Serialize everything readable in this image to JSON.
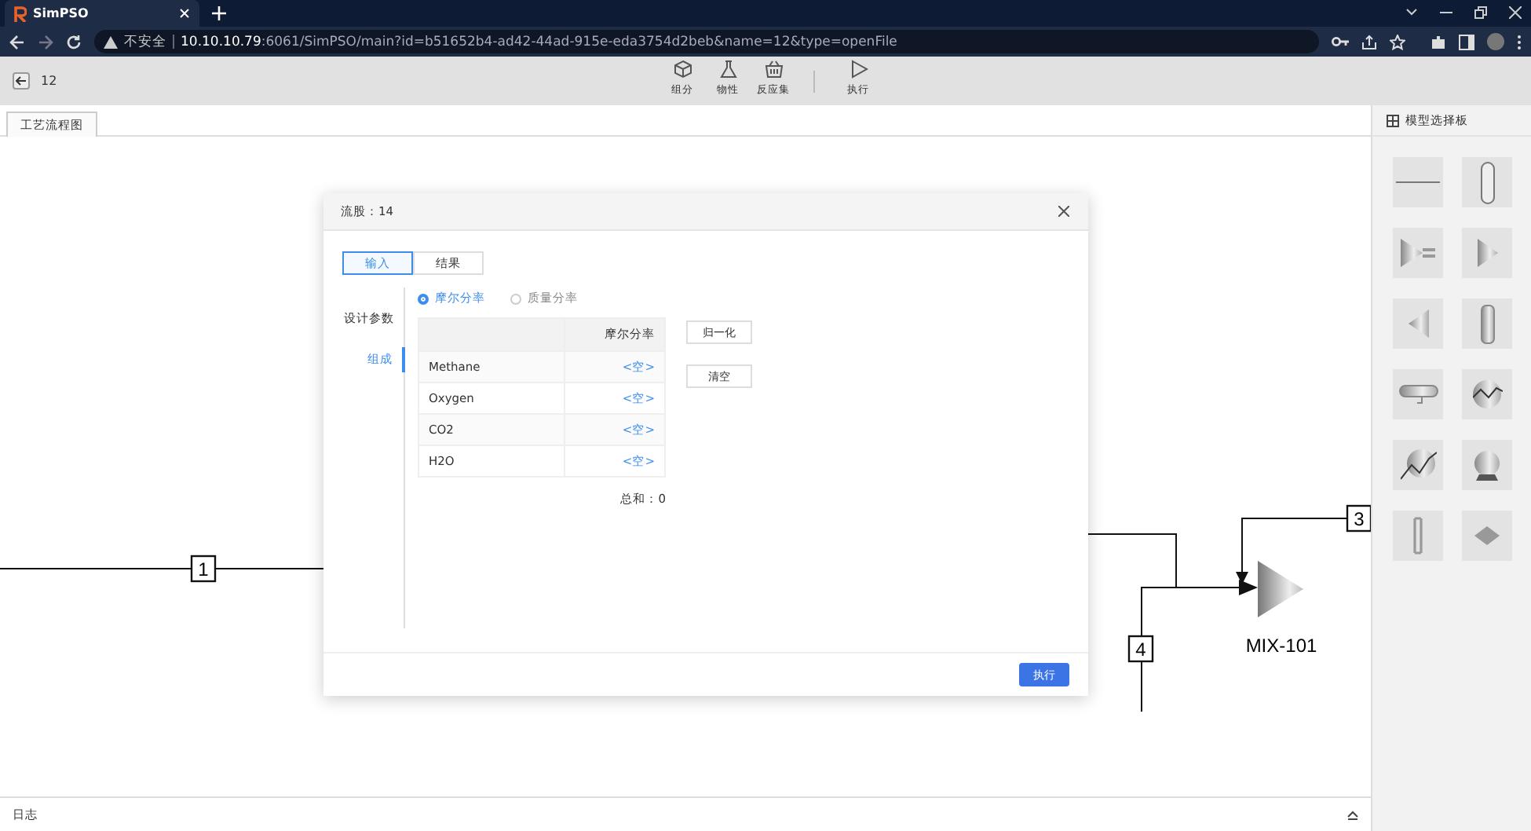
{
  "browser": {
    "tab_title": "SimPSO",
    "security": "不安全",
    "url": "**10.10.10.79**:6061/SimPSO/main?id=b51652b4-ad42-44ad-915e-eda3754d2beb&name=12&type=openFile"
  },
  "toolbar": {
    "file_name": "12",
    "tools": [
      {
        "kind": "cube",
        "label": "组分"
      },
      {
        "kind": "flask",
        "label": "物性"
      },
      {
        "kind": "basket",
        "label": "反应集"
      },
      {
        "kind": "play",
        "label": "执行"
      }
    ]
  },
  "doc_tab": "工艺流程图",
  "diagram": {
    "streams": [
      {
        "kind": "feed",
        "label": "1"
      },
      {
        "kind": "top",
        "label": "3"
      },
      {
        "kind": "bottom",
        "label": "4"
      }
    ],
    "unit": "MIX-101"
  },
  "dialog": {
    "title": "流股：14",
    "tabs": [
      {
        "label": "输入",
        "selected": true
      },
      {
        "label": "结果",
        "selected": false
      }
    ],
    "nav_heading": "设计参数",
    "nav_items": [
      {
        "label": "组成",
        "selected": true
      }
    ],
    "radios": [
      {
        "label": "摩尔分率",
        "selected": true
      },
      {
        "label": "质量分率",
        "selected": false
      }
    ],
    "table": {
      "column_header": "摩尔分率",
      "rows": [
        {
          "name": "Methane",
          "value": "<空>"
        },
        {
          "name": "Oxygen",
          "value": "<空>"
        },
        {
          "name": "CO2",
          "value": "<空>"
        },
        {
          "name": "H2O",
          "value": "<空>"
        }
      ]
    },
    "buttons": [
      "归一化",
      "清空"
    ],
    "sum": "总和：0",
    "run_button": "执行"
  },
  "palette": {
    "title": "模型选择板",
    "items": [
      {
        "kind": "line"
      },
      {
        "kind": "capsule"
      },
      {
        "kind": "splitter"
      },
      {
        "kind": "mixer"
      },
      {
        "kind": "reverse"
      },
      {
        "kind": "column"
      },
      {
        "kind": "drum"
      },
      {
        "kind": "exchanger"
      },
      {
        "kind": "heater"
      },
      {
        "kind": "compressor"
      },
      {
        "kind": "tower"
      },
      {
        "kind": "reactor"
      }
    ]
  },
  "log": {
    "label": "日志"
  }
}
